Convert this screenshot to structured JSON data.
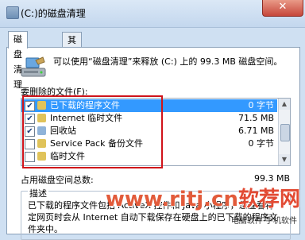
{
  "window": {
    "title": "(C:)的磁盘清理",
    "close_glyph": "✕"
  },
  "tabs": [
    {
      "label": "磁盘清理",
      "active": true
    },
    {
      "label": "其他选项",
      "active": false
    }
  ],
  "intro": "可以使用“磁盘清理”来释放 (C:) 上的 99.3 MB 磁盘空间。",
  "list_label": "要删除的文件(F):",
  "files": [
    {
      "name": "已下载的程序文件",
      "size": "0 字节",
      "checked": true,
      "selected": true,
      "icon_color": "#e0c35a"
    },
    {
      "name": "Internet 临时文件",
      "size": "71.5 MB",
      "checked": true,
      "selected": false,
      "icon_color": "#e0c35a"
    },
    {
      "name": "回收站",
      "size": "6.71 MB",
      "checked": true,
      "selected": false,
      "icon_color": "#8fb3d9"
    },
    {
      "name": "Service Pack 备份文件",
      "size": "0 字节",
      "checked": false,
      "selected": false,
      "icon_color": "#e0c35a"
    },
    {
      "name": "临时文件",
      "size": "",
      "checked": false,
      "selected": false,
      "icon_color": "#e0c35a"
    }
  ],
  "total": {
    "label": "占用磁盘空间总数:",
    "value": "99.3 MB"
  },
  "description": {
    "title": "描述",
    "text": "已下载的程序文件包括 ActiveX 控件和 Java 小程序，您查看特定网页时会从 Internet 自动下载保存在硬盘上的已下载的程序文件夹中。"
  },
  "watermark": {
    "main": "www.ritj.cn",
    "suffix": "软荐网",
    "site": "电脑软件·手机软件"
  },
  "colors": {
    "selection": "#3399ff",
    "highlight_box": "#d0131a",
    "watermark": "#e24a33"
  }
}
